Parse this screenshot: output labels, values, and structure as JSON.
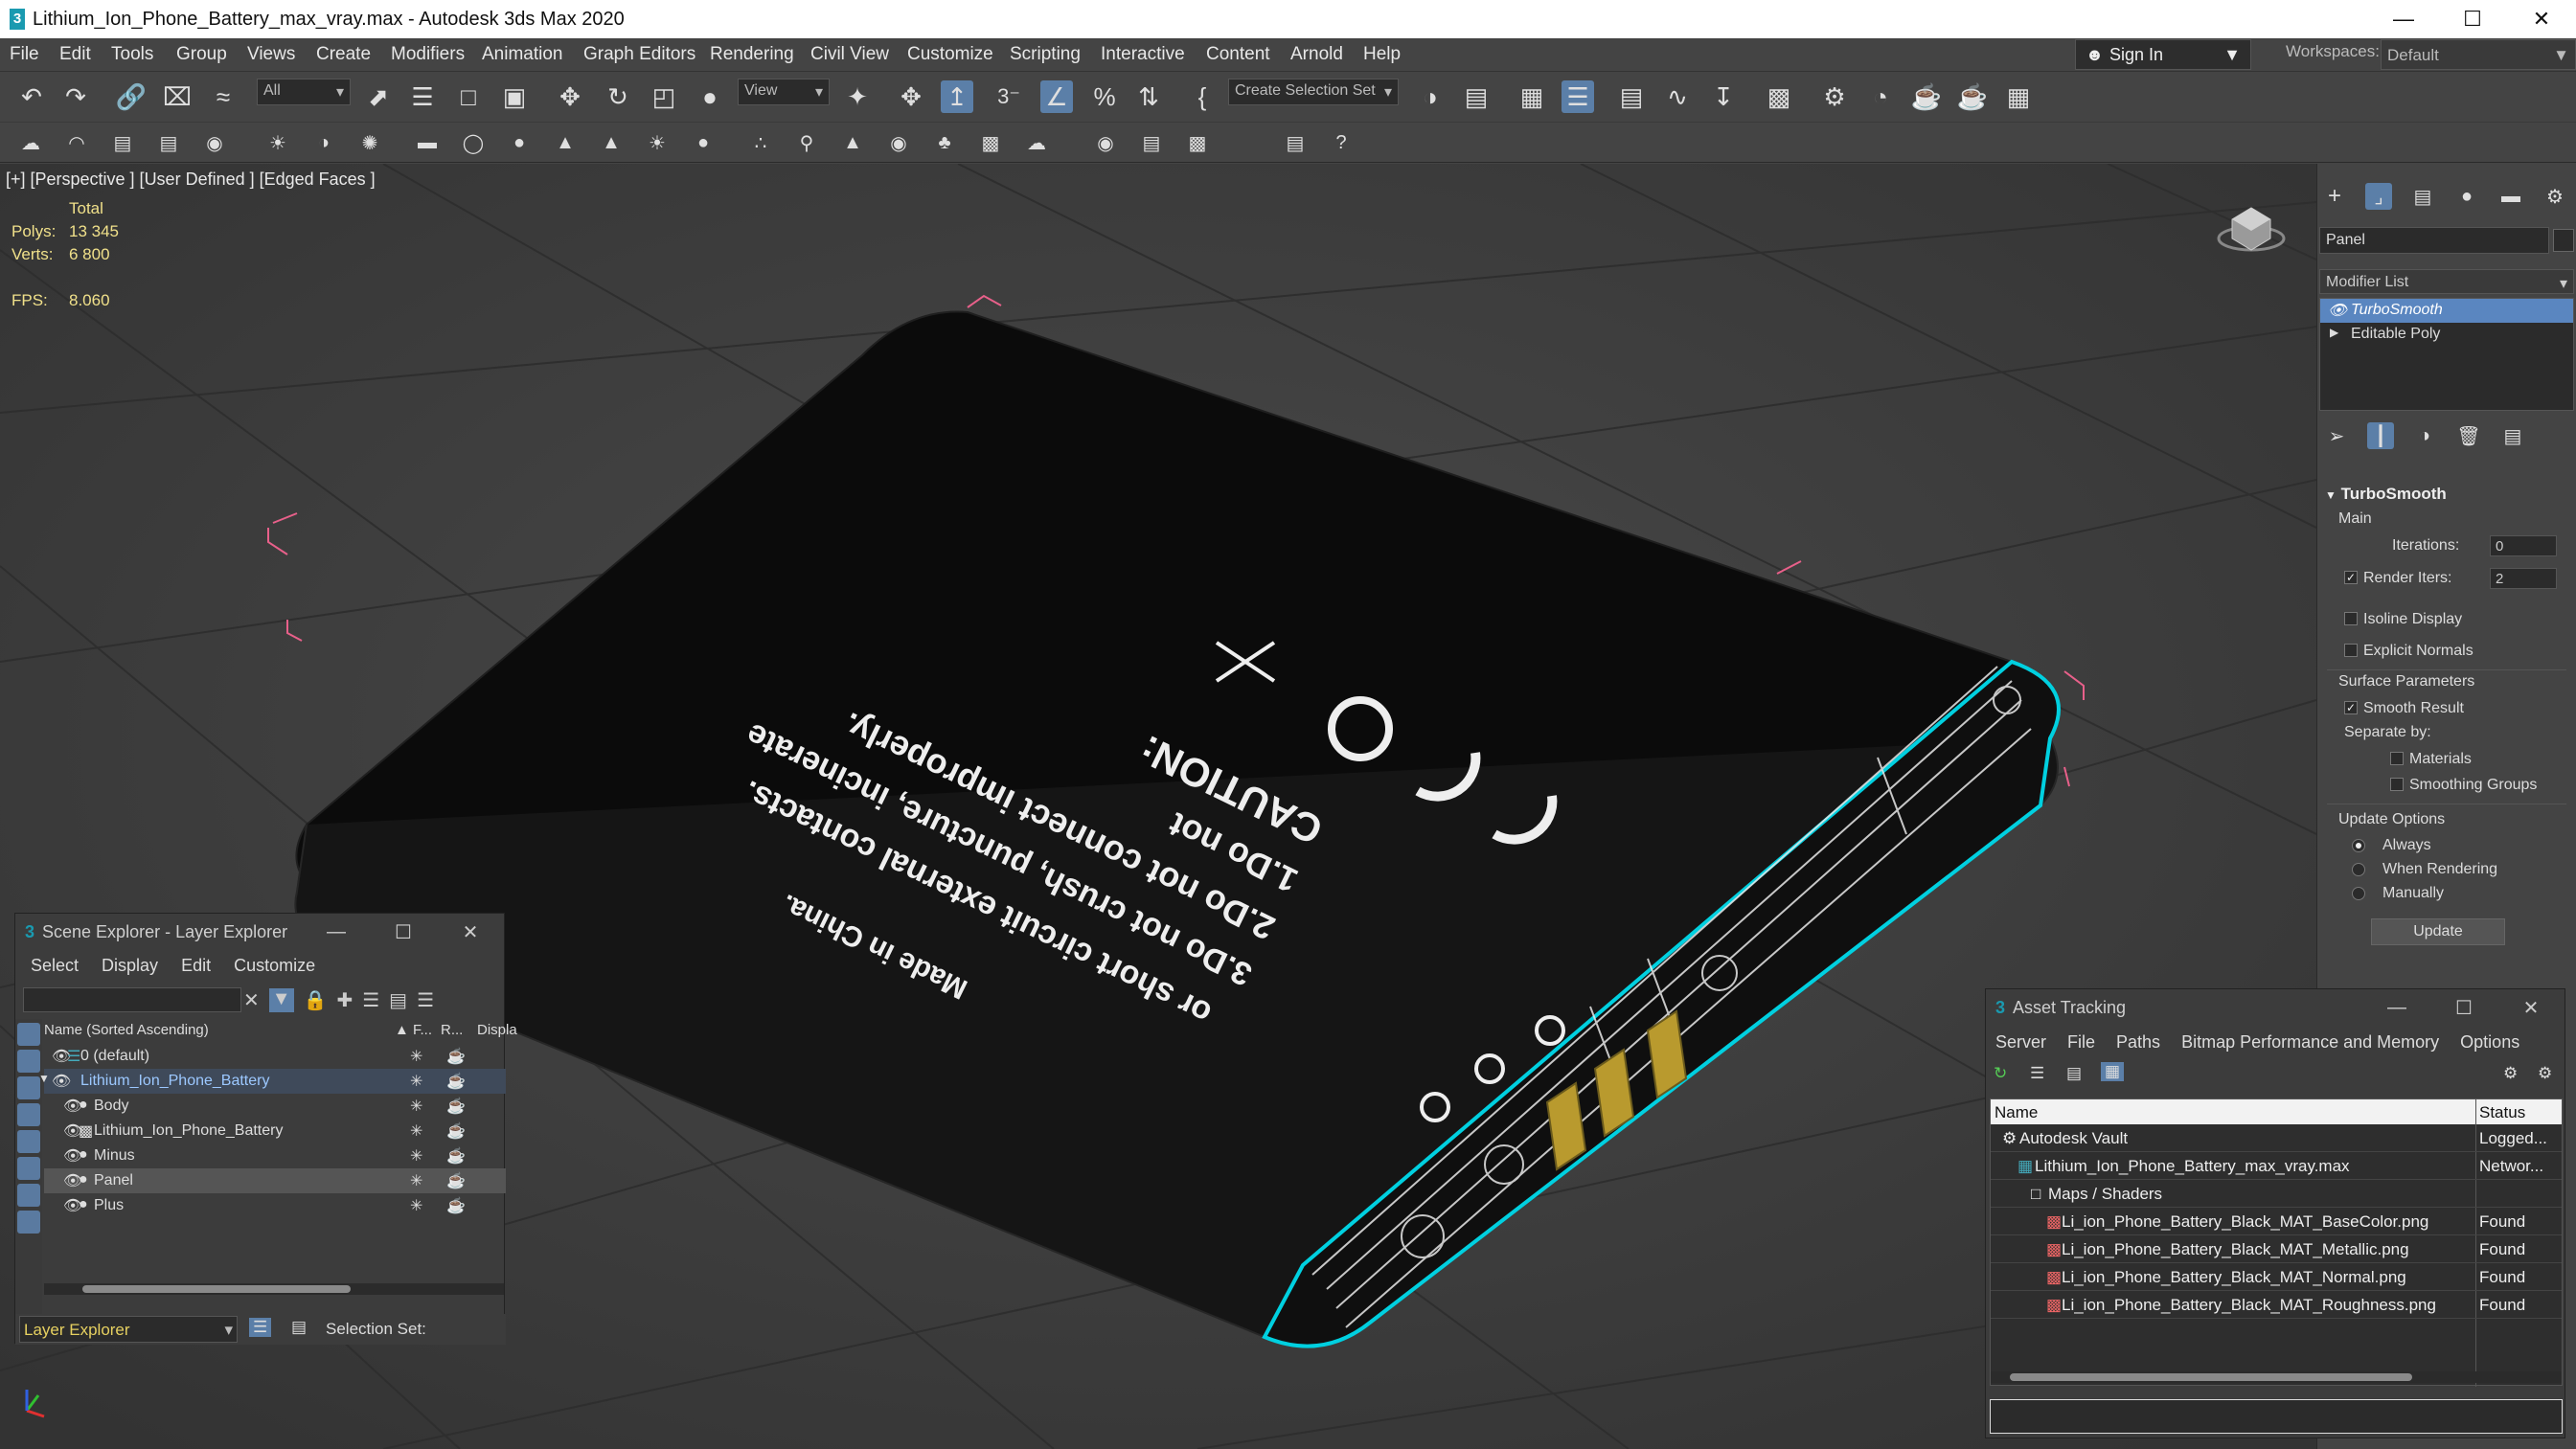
{
  "window": {
    "title": "Lithium_Ion_Phone_Battery_max_vray.max - Autodesk 3ds Max 2020"
  },
  "menu": [
    "File",
    "Edit",
    "Tools",
    "Group",
    "Views",
    "Create",
    "Modifiers",
    "Animation",
    "Graph Editors",
    "Rendering",
    "Civil View",
    "Customize",
    "Scripting",
    "Interactive",
    "Content",
    "Arnold",
    "Help"
  ],
  "account": {
    "sign_in": "Sign In",
    "workspaces_label": "Workspaces:",
    "workspace_value": "Default"
  },
  "toolbar": {
    "filter": "All",
    "ref_coord": "View",
    "selection_set": "Create Selection Set",
    "snap_value": "3"
  },
  "viewport": {
    "label": "[+] [Perspective ] [User Defined ] [Edged Faces ]",
    "stats": {
      "total": "Total",
      "polys_label": "Polys:",
      "polys": "13 345",
      "verts_label": "Verts:",
      "verts": "6 800",
      "fps_label": "FPS:",
      "fps": "8.060"
    },
    "battery_text": [
      "Made in China.",
      "or short circuit external contacts.",
      "3.Do not crush, puncture, incinerate",
      "2.Do not connect improperly.",
      "1.Do not",
      "CAUTION:"
    ]
  },
  "command_panel": {
    "object_name": "Panel",
    "modifier_list": "Modifier List",
    "stack": [
      "TurboSmooth",
      "Editable Poly"
    ],
    "rollout": "TurboSmooth",
    "main": "Main",
    "iterations_label": "Iterations:",
    "iterations": "0",
    "render_iters_label": "Render Iters:",
    "render_iters": "2",
    "isoline": "Isoline Display",
    "explicit_normals": "Explicit Normals",
    "surface_params": "Surface Parameters",
    "smooth_result": "Smooth Result",
    "separate_by": "Separate by:",
    "materials": "Materials",
    "smoothing_groups": "Smoothing Groups",
    "update_options": "Update Options",
    "always": "Always",
    "when_rendering": "When Rendering",
    "manually": "Manually",
    "update": "Update"
  },
  "scene_explorer": {
    "title": "Scene Explorer - Layer Explorer",
    "menu": [
      "Select",
      "Display",
      "Edit",
      "Customize"
    ],
    "col_name": "Name (Sorted Ascending)",
    "col_f": "▲ F...",
    "col_r": "R...",
    "col_disp": "Displa",
    "rows": [
      {
        "name": "0 (default)",
        "indent": 1
      },
      {
        "name": "Lithium_Ion_Phone_Battery",
        "indent": 1
      },
      {
        "name": "Body",
        "indent": 2
      },
      {
        "name": "Lithium_Ion_Phone_Battery",
        "indent": 2
      },
      {
        "name": "Minus",
        "indent": 2
      },
      {
        "name": "Panel",
        "indent": 2
      },
      {
        "name": "Plus",
        "indent": 2
      }
    ],
    "footer_mode": "Layer Explorer",
    "selection_set": "Selection Set:"
  },
  "asset_tracking": {
    "title": "Asset Tracking",
    "menu": [
      "Server",
      "File",
      "Paths",
      "Bitmap Performance and Memory",
      "Options"
    ],
    "col_name": "Name",
    "col_status": "Status",
    "rows": [
      {
        "name": "Autodesk Vault",
        "status": "Logged...",
        "indent": 0
      },
      {
        "name": "Lithium_Ion_Phone_Battery_max_vray.max",
        "status": "Networ...",
        "indent": 1
      },
      {
        "name": "Maps / Shaders",
        "status": "",
        "indent": 2
      },
      {
        "name": "Li_ion_Phone_Battery_Black_MAT_BaseColor.png",
        "status": "Found",
        "indent": 3
      },
      {
        "name": "Li_ion_Phone_Battery_Black_MAT_Metallic.png",
        "status": "Found",
        "indent": 3
      },
      {
        "name": "Li_ion_Phone_Battery_Black_MAT_Normal.png",
        "status": "Found",
        "indent": 3
      },
      {
        "name": "Li_ion_Phone_Battery_Black_MAT_Roughness.png",
        "status": "Found",
        "indent": 3
      }
    ]
  }
}
